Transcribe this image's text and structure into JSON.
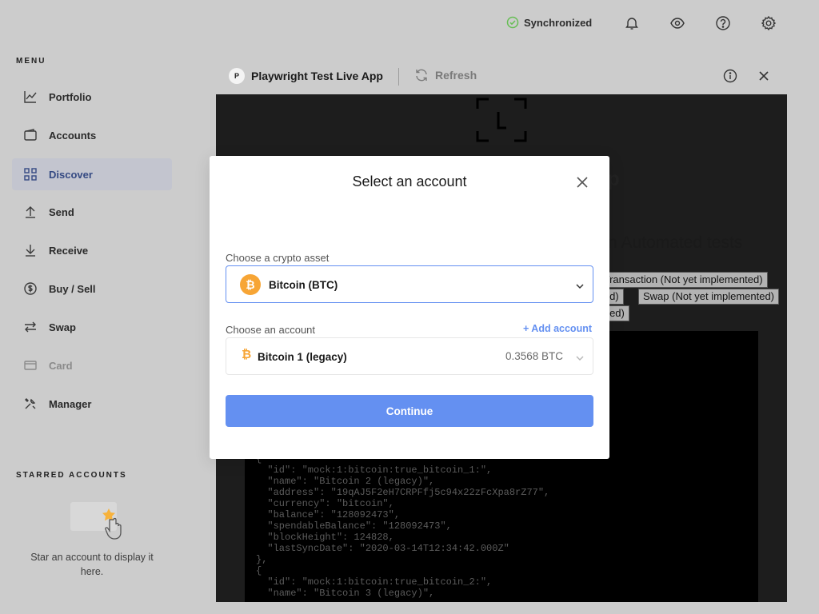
{
  "sidebar": {
    "menu_title": "MENU",
    "items": [
      {
        "label": "Portfolio",
        "icon": "chart-line-icon"
      },
      {
        "label": "Accounts",
        "icon": "wallet-icon"
      },
      {
        "label": "Discover",
        "icon": "grid-icon"
      },
      {
        "label": "Send",
        "icon": "arrow-up-icon"
      },
      {
        "label": "Receive",
        "icon": "arrow-down-icon"
      },
      {
        "label": "Buy / Sell",
        "icon": "dollar-circle-icon"
      },
      {
        "label": "Swap",
        "icon": "swap-icon"
      },
      {
        "label": "Card",
        "icon": "card-icon"
      },
      {
        "label": "Manager",
        "icon": "tools-icon"
      }
    ],
    "active_item": "Discover",
    "disabled_item": "Card",
    "starred_title": "STARRED ACCOUNTS",
    "starred_empty_text": "Star an account to display it here."
  },
  "topbar": {
    "sync_status": "Synchronized",
    "icons": [
      "bell-icon",
      "eye-icon",
      "help-icon",
      "settings-icon"
    ]
  },
  "live_app": {
    "app_logo_letter": "P",
    "title": "Playwright Test Live App",
    "refresh_label": "Refresh",
    "heading_partial": "App",
    "subtitle_partial": "d in Automated tests",
    "buttons": [
      "n Transaction (Not yet implemented)",
      "nted)",
      "Swap (Not yet implemented)",
      "ented)"
    ],
    "json_text": "{\n  \"id\": \"mock:1:bitcoin:true_bitcoin_1:\",\n  \"name\": \"Bitcoin 2 (legacy)\",\n  \"address\": \"19qAJ5F2eH7CRPFfj5c94x22zFcXpa8rZ77\",\n  \"currency\": \"bitcoin\",\n  \"balance\": \"128092473\",\n  \"spendableBalance\": \"128092473\",\n  \"blockHeight\": 124828,\n  \"lastSyncDate\": \"2020-03-14T12:34:42.000Z\"\n},\n{\n  \"id\": \"mock:1:bitcoin:true_bitcoin_2:\",\n  \"name\": \"Bitcoin 3 (legacy)\","
  },
  "modal": {
    "title": "Select an account",
    "asset_label": "Choose a crypto asset",
    "asset_value": "Bitcoin (BTC)",
    "account_label": "Choose an account",
    "add_account_label": "+ Add account",
    "account_name": "Bitcoin 1 (legacy)",
    "account_balance": "0.3568 BTC",
    "continue_label": "Continue"
  },
  "colors": {
    "accent": "#6490f1",
    "bitcoin": "#f7a535",
    "sync_ok": "#66be54"
  }
}
